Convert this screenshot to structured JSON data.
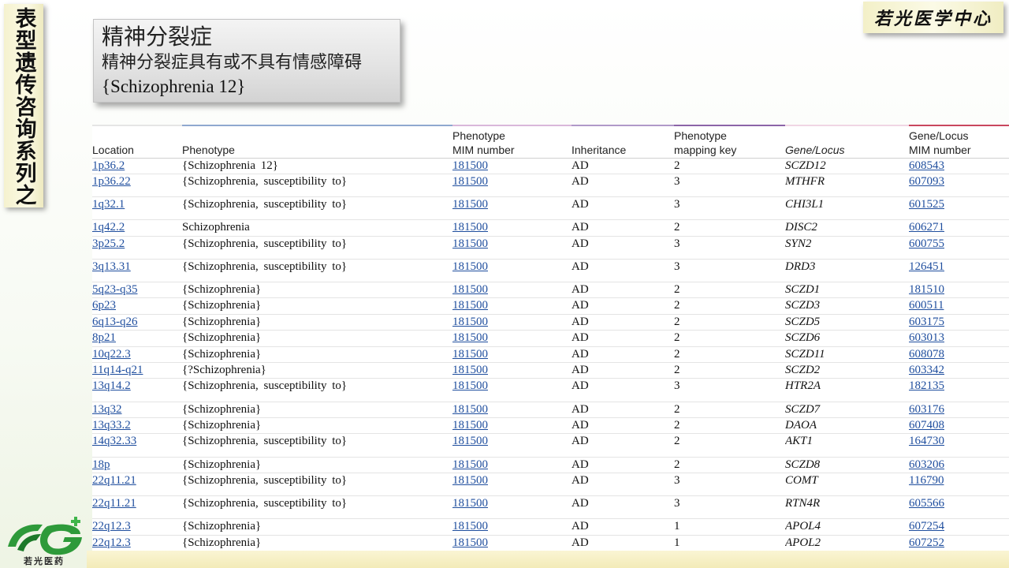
{
  "side_banner": "表型遗传咨询系列之",
  "org_name": "若光医学中心",
  "title": {
    "main": "精神分裂症",
    "sub": "精神分裂症具有或不具有情感障碍",
    "en": "{Schizophrenia 12}"
  },
  "table": {
    "headers": [
      "Location",
      "Phenotype",
      "Phenotype\nMIM number",
      "Inheritance",
      "Phenotype\nmapping key",
      "Gene/Locus",
      "Gene/Locus\nMIM number"
    ],
    "rows": [
      {
        "location": "1p36.2",
        "phenotype": "{Schizophrenia 12}",
        "mim": "181500",
        "inheritance": "AD",
        "key": "2",
        "gene": "SCZD12",
        "gene_mim": "608543",
        "tall": false
      },
      {
        "location": "1p36.22",
        "phenotype": "{Schizophrenia, susceptibility to}",
        "mim": "181500",
        "inheritance": "AD",
        "key": "3",
        "gene": "MTHFR",
        "gene_mim": "607093",
        "tall": true
      },
      {
        "location": "1q32.1",
        "phenotype": "{Schizophrenia, susceptibility to}",
        "mim": "181500",
        "inheritance": "AD",
        "key": "3",
        "gene": "CHI3L1",
        "gene_mim": "601525",
        "tall": true
      },
      {
        "location": "1q42.2",
        "phenotype": "Schizophrenia",
        "mim": "181500",
        "inheritance": "AD",
        "key": "2",
        "gene": "DISC2",
        "gene_mim": "606271",
        "tall": false
      },
      {
        "location": "3p25.2",
        "phenotype": "{Schizophrenia, susceptibility to}",
        "mim": "181500",
        "inheritance": "AD",
        "key": "3",
        "gene": "SYN2",
        "gene_mim": "600755",
        "tall": true
      },
      {
        "location": "3q13.31",
        "phenotype": "{Schizophrenia, susceptibility to}",
        "mim": "181500",
        "inheritance": "AD",
        "key": "3",
        "gene": "DRD3",
        "gene_mim": "126451",
        "tall": true
      },
      {
        "location": "5q23-q35",
        "phenotype": "{Schizophrenia}",
        "mim": "181500",
        "inheritance": "AD",
        "key": "2",
        "gene": "SCZD1",
        "gene_mim": "181510",
        "tall": false
      },
      {
        "location": "6p23",
        "phenotype": "{Schizophrenia}",
        "mim": "181500",
        "inheritance": "AD",
        "key": "2",
        "gene": "SCZD3",
        "gene_mim": "600511",
        "tall": false
      },
      {
        "location": "6q13-q26",
        "phenotype": "{Schizophrenia}",
        "mim": "181500",
        "inheritance": "AD",
        "key": "2",
        "gene": "SCZD5",
        "gene_mim": "603175",
        "tall": false
      },
      {
        "location": "8p21",
        "phenotype": "{Schizophrenia}",
        "mim": "181500",
        "inheritance": "AD",
        "key": "2",
        "gene": "SCZD6",
        "gene_mim": "603013",
        "tall": false
      },
      {
        "location": "10q22.3",
        "phenotype": "{Schizophrenia}",
        "mim": "181500",
        "inheritance": "AD",
        "key": "2",
        "gene": "SCZD11",
        "gene_mim": "608078",
        "tall": false
      },
      {
        "location": "11q14-q21",
        "phenotype": "{?Schizophrenia}",
        "mim": "181500",
        "inheritance": "AD",
        "key": "2",
        "gene": "SCZD2",
        "gene_mim": "603342",
        "tall": false
      },
      {
        "location": "13q14.2",
        "phenotype": "{Schizophrenia, susceptibility to}",
        "mim": "181500",
        "inheritance": "AD",
        "key": "3",
        "gene": "HTR2A",
        "gene_mim": "182135",
        "tall": true
      },
      {
        "location": "13q32",
        "phenotype": "{Schizophrenia}",
        "mim": "181500",
        "inheritance": "AD",
        "key": "2",
        "gene": "SCZD7",
        "gene_mim": "603176",
        "tall": false
      },
      {
        "location": "13q33.2",
        "phenotype": "{Schizophrenia}",
        "mim": "181500",
        "inheritance": "AD",
        "key": "2",
        "gene": "DAOA",
        "gene_mim": "607408",
        "tall": false
      },
      {
        "location": "14q32.33",
        "phenotype": "{Schizophrenia, susceptibility to}",
        "mim": "181500",
        "inheritance": "AD",
        "key": "2",
        "gene": "AKT1",
        "gene_mim": "164730",
        "tall": true
      },
      {
        "location": "18p",
        "phenotype": "{Schizophrenia}",
        "mim": "181500",
        "inheritance": "AD",
        "key": "2",
        "gene": "SCZD8",
        "gene_mim": "603206",
        "tall": false
      },
      {
        "location": "22q11.21",
        "phenotype": "{Schizophrenia, susceptibility to}",
        "mim": "181500",
        "inheritance": "AD",
        "key": "3",
        "gene": "COMT",
        "gene_mim": "116790",
        "tall": true
      },
      {
        "location": "22q11.21",
        "phenotype": "{Schizophrenia, susceptibility to}",
        "mim": "181500",
        "inheritance": "AD",
        "key": "3",
        "gene": "RTN4R",
        "gene_mim": "605566",
        "tall": true
      },
      {
        "location": "22q12.3",
        "phenotype": "{Schizophrenia}",
        "mim": "181500",
        "inheritance": "AD",
        "key": "1",
        "gene": "APOL4",
        "gene_mim": "607254",
        "tall": false
      },
      {
        "location": "22q12.3",
        "phenotype": "{Schizophrenia}",
        "mim": "181500",
        "inheritance": "AD",
        "key": "1",
        "gene": "APOL2",
        "gene_mim": "607252",
        "tall": false
      }
    ]
  },
  "logo": {
    "caption": "若光医药",
    "colors": {
      "green": "#2e9a3a",
      "dark_green": "#1d7a2a",
      "cross": "#3fb54a"
    }
  },
  "colors": {
    "link": "#1f4e9e",
    "banner_bg": "#f5f2cf"
  }
}
